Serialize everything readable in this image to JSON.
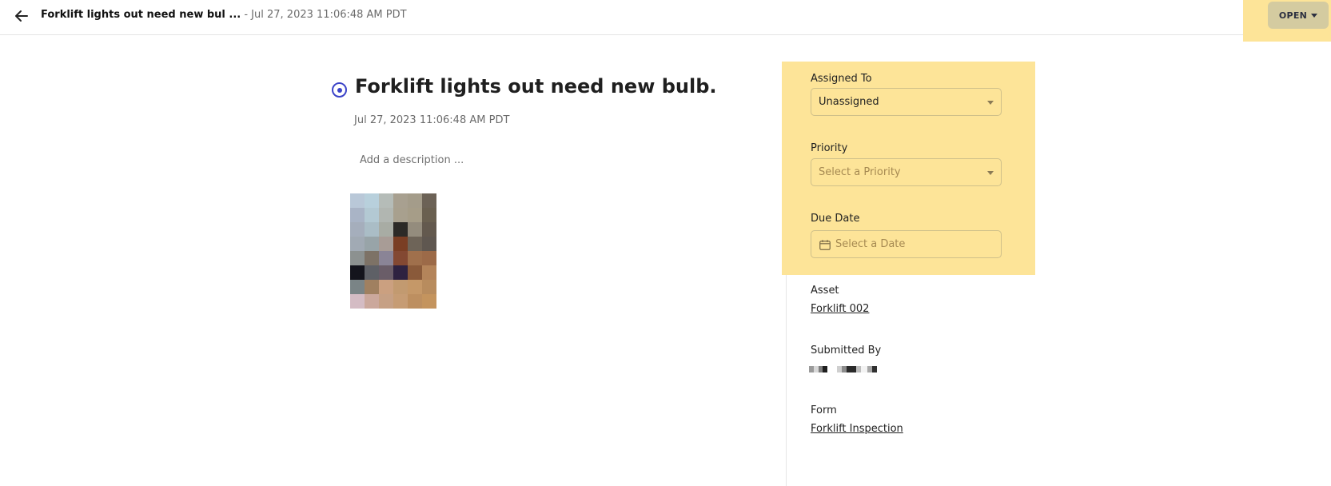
{
  "header": {
    "title": "Forklift lights out need new bul ...",
    "date": "- Jul 27, 2023 11:06:48 AM PDT",
    "status_label": "OPEN",
    "icons": {
      "back": "arrow-left-icon",
      "status_caret": "caret-down-icon"
    }
  },
  "issue": {
    "title": "Forklift lights out need new bulb.",
    "created": "Jul 27, 2023 11:06:48 AM PDT",
    "description_placeholder": "Add a description ...",
    "status_icon": "radio-target-icon",
    "status_color": "#3b43c8"
  },
  "details": {
    "assigned_to": {
      "label": "Assigned To",
      "value": "Unassigned"
    },
    "priority": {
      "label": "Priority",
      "placeholder": "Select a Priority"
    },
    "due_date": {
      "label": "Due Date",
      "placeholder": "Select a Date",
      "icon": "calendar-icon"
    },
    "asset": {
      "label": "Asset",
      "value": "Forklift 002"
    },
    "submitted_by": {
      "label": "Submitted By"
    },
    "form": {
      "label": "Form",
      "value": "Forklift Inspection"
    }
  },
  "colors": {
    "highlight": "#fde498",
    "status_button": "#d4cba0",
    "accent": "#3b43c8"
  }
}
